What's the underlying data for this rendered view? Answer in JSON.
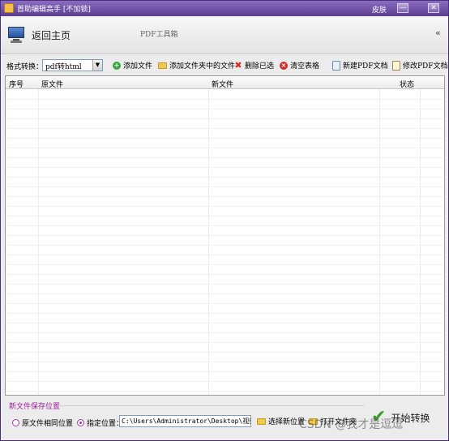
{
  "window": {
    "title": "首助编辑高手 [不加锁]",
    "skin_label": "皮肤",
    "minimize_glyph": "—",
    "close_glyph": "✕"
  },
  "header": {
    "home_label": "返回主页",
    "tool_title": "PDF工具箱",
    "collapse_glyph": "«",
    "home_icon": "monitor-icon"
  },
  "toolbar": {
    "format_label": "格式转换：",
    "format_value": "pdf转html",
    "add_file": "添加文件",
    "add_folder_files": "添加文件夹中的文件",
    "delete_selected": "删除已选",
    "clear_table": "清空表格",
    "new_pdf": "新建PDF文档",
    "edit_pdf": "修改PDF文档"
  },
  "table": {
    "columns": [
      "序号",
      "原文件",
      "新文件",
      "状态"
    ],
    "rows": []
  },
  "save": {
    "section_label": "新文件保存位置",
    "option_same": "原文件相同位置",
    "option_custom": "指定位置：",
    "selected": "custom",
    "path_value": "C:\\Users\\Administrator\\Desktop\\视频剪辑\\",
    "choose_location": "选择新位置",
    "open_folder": "打开文件夹",
    "start_label": "开始转换"
  },
  "watermark": "CSDN @我才是逗逗",
  "colors": {
    "titlebar": "#5b3d92",
    "accent_purple": "#a020a0",
    "start_check": "#3b9b2a"
  }
}
